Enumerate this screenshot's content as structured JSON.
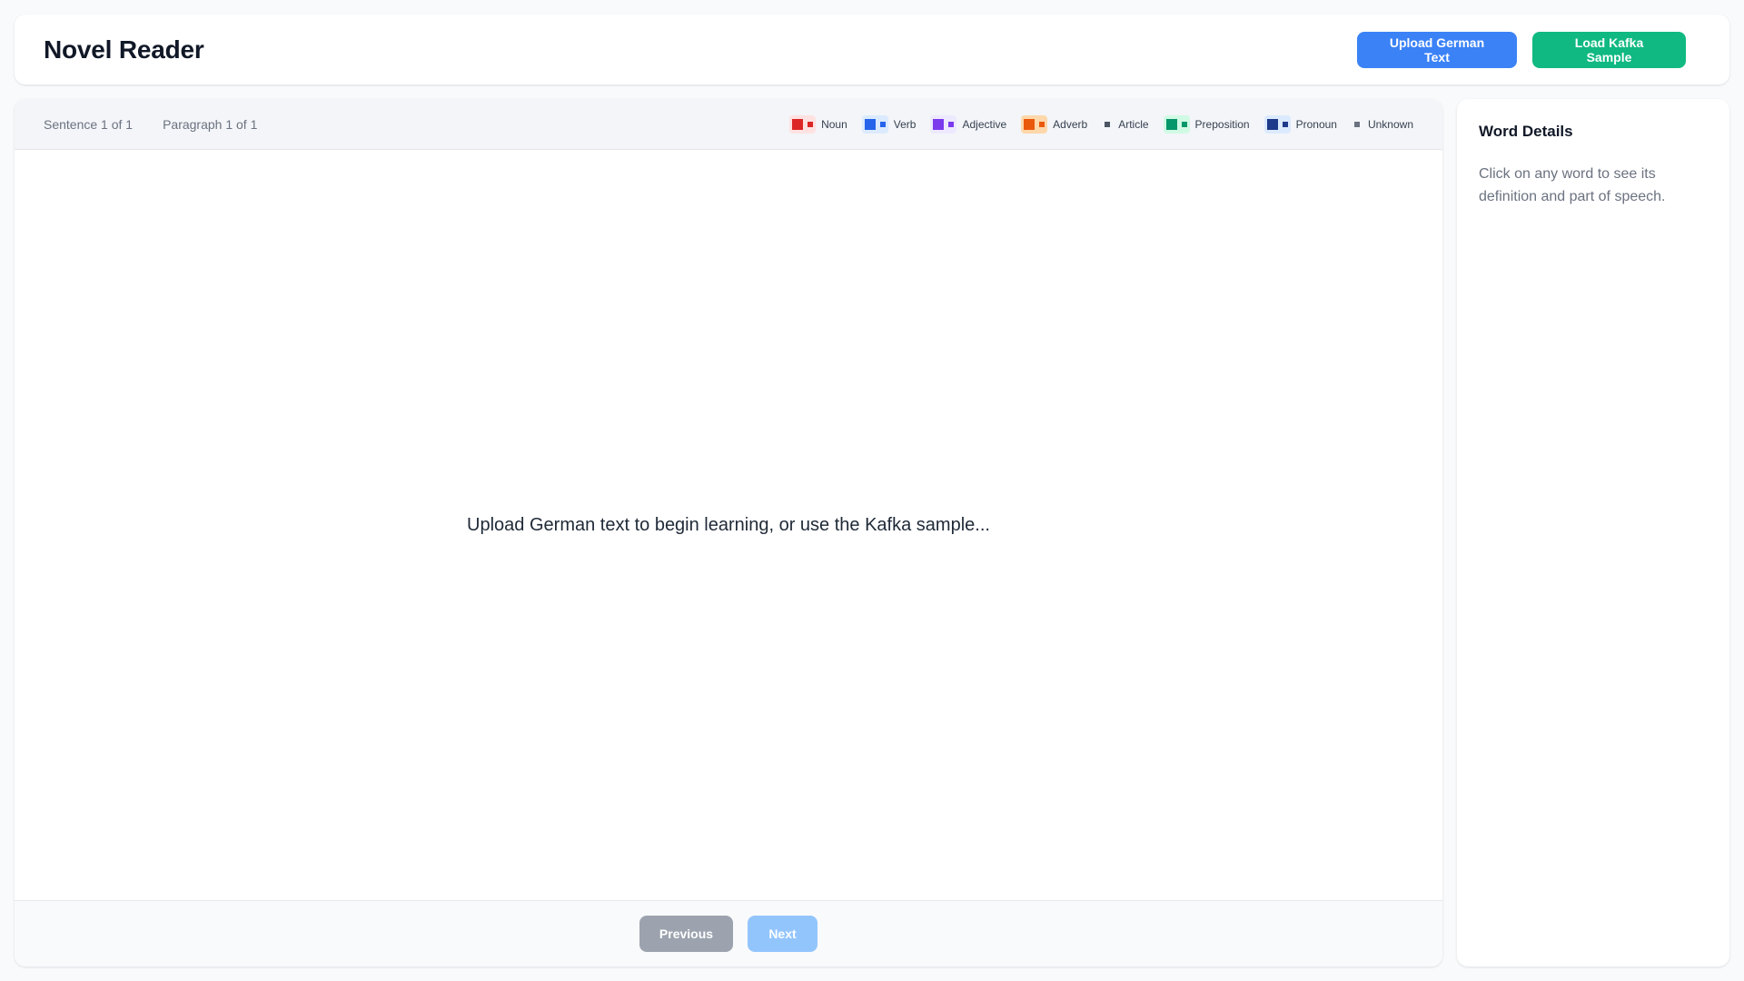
{
  "header": {
    "title": "Novel Reader",
    "upload_label": "Upload German Text",
    "kafka_label": "Load Kafka Sample"
  },
  "reader": {
    "sentence_progress": "Sentence 1 of 1",
    "paragraph_progress": "Paragraph 1 of 1",
    "placeholder": "Upload German text to begin learning, or use the Kafka sample...",
    "prev_label": "Previous",
    "next_label": "Next"
  },
  "legend": [
    {
      "label": "Noun",
      "color": "#dc2626",
      "bg": "#fee2e2",
      "icon": "noun-swatch-icon"
    },
    {
      "label": "Verb",
      "color": "#2563eb",
      "bg": "#dbeafe",
      "icon": "verb-swatch-icon"
    },
    {
      "label": "Adjective",
      "color": "#7c3aed",
      "bg": "#ede9fe",
      "icon": "adjective-swatch-icon"
    },
    {
      "label": "Adverb",
      "color": "#ea580c",
      "bg": "#fed7aa",
      "icon": "adverb-swatch-icon"
    },
    {
      "label": "Article",
      "color": "#4b5563",
      "bg": "transparent",
      "icon": "article-swatch-icon"
    },
    {
      "label": "Preposition",
      "color": "#059669",
      "bg": "#d1fae5",
      "icon": "preposition-swatch-icon"
    },
    {
      "label": "Pronoun",
      "color": "#1e3a8a",
      "bg": "#dbeafe",
      "icon": "pronoun-swatch-icon"
    },
    {
      "label": "Unknown",
      "color": "#6b7280",
      "bg": "transparent",
      "icon": "unknown-swatch-icon"
    }
  ],
  "details": {
    "title": "Word Details",
    "hint": "Click on any word to see its definition and part of speech."
  },
  "colors": {
    "upload_button": "#3b82f6",
    "kafka_button": "#10b981",
    "prev_disabled": "#9ca3af",
    "next_disabled": "#93c5fd"
  }
}
